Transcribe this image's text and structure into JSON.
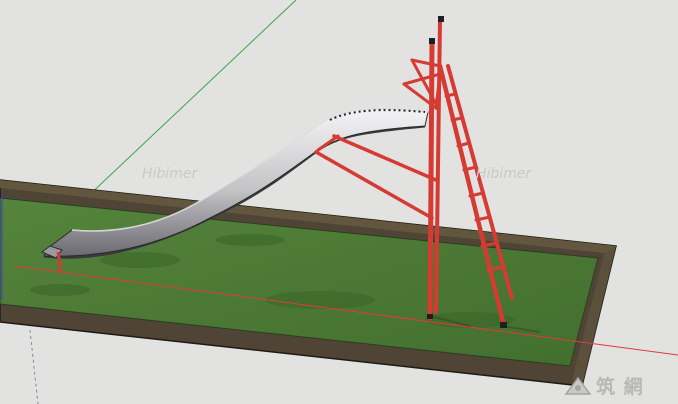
{
  "scene": {
    "kind": "sketchup-3d-model",
    "subject": "playground slide",
    "colors": {
      "background": "#e2e2e1",
      "grass": "#4d7a35",
      "grass_dark": "#3f6a2c",
      "border_wood": "#4f4435",
      "frame_red": "#d63b33",
      "slide_metal": "#c9c9cb",
      "axis_red": "#e23a3a",
      "axis_green": "#3aa64a",
      "axis_blue": "#3a3ae0"
    }
  },
  "watermarks": {
    "left": "Hibimer",
    "right": "Hibimer"
  },
  "logo": {
    "text": "筑 網"
  }
}
